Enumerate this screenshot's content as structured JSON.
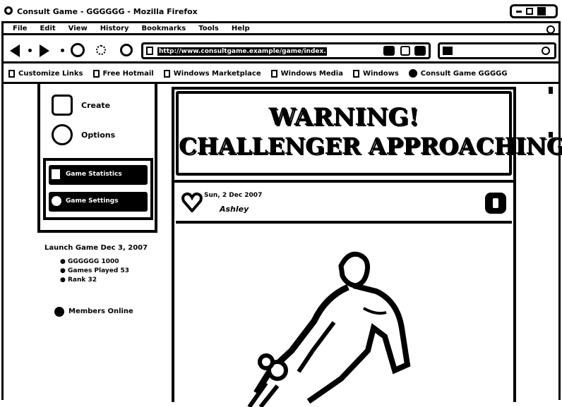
{
  "window": {
    "title": "Consult Game - GGGGGG - Mozilla Firefox"
  },
  "menubar": {
    "items": [
      "File",
      "Edit",
      "View",
      "History",
      "Bookmarks",
      "Tools",
      "Help"
    ]
  },
  "toolbar": {
    "address": "http://www.consultgame.example/game/index.php"
  },
  "bookmarks": [
    {
      "label": "Customize Links"
    },
    {
      "label": "Free Hotmail"
    },
    {
      "label": "Windows Marketplace"
    },
    {
      "label": "Windows Media"
    },
    {
      "label": "Windows"
    },
    {
      "label": "Consult Game GGGGG"
    }
  ],
  "sidebar": {
    "items": [
      {
        "label": "Create"
      },
      {
        "label": "Options"
      }
    ],
    "highlighted": [
      {
        "label": "Game Statistics"
      },
      {
        "label": "Game Settings"
      }
    ],
    "footer_title": "Launch Game Dec 3, 2007",
    "footer_list": [
      "GGGGGG 1000",
      "Games Played 53",
      "Rank 32"
    ],
    "online": "Members Online"
  },
  "banner": {
    "line1": "WARNING!",
    "line2": "CHALLENGER APPROACHING!"
  },
  "card": {
    "date": "Sun, 2 Dec 2007",
    "status": "Ashley"
  },
  "colors": {
    "ink": "#000000",
    "paper": "#ffffff"
  }
}
